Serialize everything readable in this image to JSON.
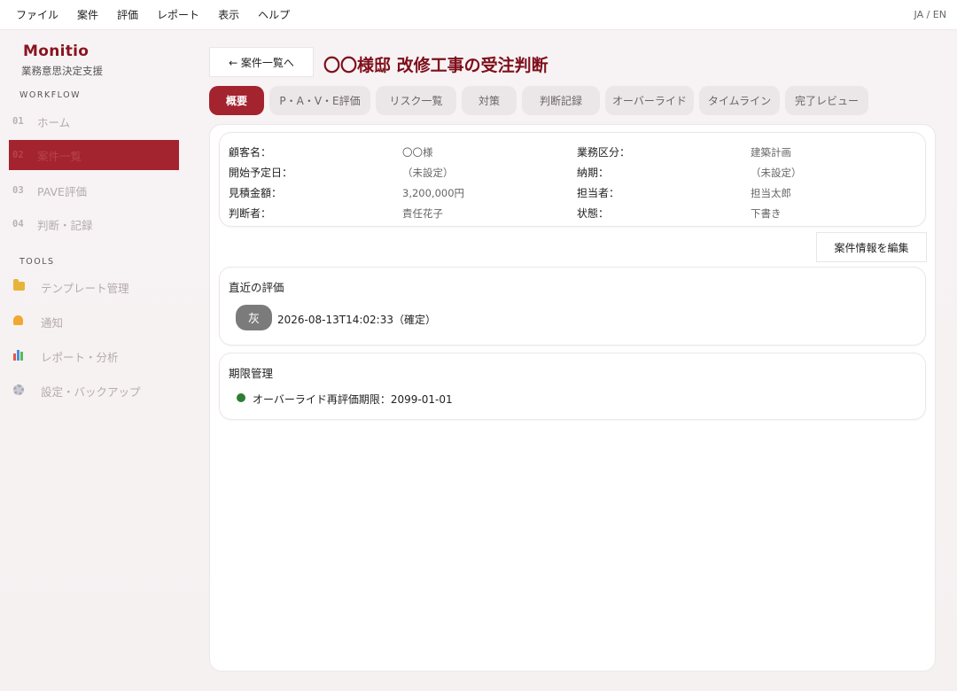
{
  "menubar": {
    "items": [
      "ファイル",
      "案件",
      "評価",
      "レポート",
      "表示",
      "ヘルプ"
    ],
    "lang": "JA / EN"
  },
  "sidebar": {
    "brand": "Monitio",
    "brand_sub": "業務意思決定支援",
    "workflow_title": "WORKFLOW",
    "workflow": [
      {
        "num": "01",
        "label": "ホーム"
      },
      {
        "num": "02",
        "label": "案件一覧"
      },
      {
        "num": "03",
        "label": "PAVE評価"
      },
      {
        "num": "04",
        "label": "判断・記録"
      }
    ],
    "tools_title": "TOOLS",
    "tools": [
      {
        "icon": "folder-icon",
        "label": "テンプレート管理"
      },
      {
        "icon": "bell-icon",
        "label": "通知"
      },
      {
        "icon": "bar-chart-icon",
        "label": "レポート・分析"
      },
      {
        "icon": "gear-icon",
        "label": "設定・バックアップ"
      }
    ]
  },
  "header": {
    "back_label": "← 案件一覧へ",
    "title": "〇〇様邸 改修工事の受注判断"
  },
  "tabs": [
    {
      "label": "概要",
      "active": true
    },
    {
      "label": "P・A・V・E評価"
    },
    {
      "label": "リスク一覧"
    },
    {
      "label": "対策"
    },
    {
      "label": "判断記録"
    },
    {
      "label": "オーバーライド"
    },
    {
      "label": "タイムライン"
    },
    {
      "label": "完了レビュー"
    }
  ],
  "info": {
    "rows": [
      {
        "k1": "顧客名：",
        "v1": "〇〇様",
        "k2": "業務区分：",
        "v2": "建築計画"
      },
      {
        "k1": "開始予定日：",
        "v1": "（未設定）",
        "k2": "納期：",
        "v2": "（未設定）"
      },
      {
        "k1": "見積金額：",
        "v1": "3,200,000円",
        "k2": "担当者：",
        "v2": "担当太郎"
      },
      {
        "k1": "判断者：",
        "v1": "責任花子",
        "k2": "状態：",
        "v2": "下書き"
      }
    ],
    "edit_label": "案件情報を編集"
  },
  "recent_eval": {
    "title": "直近の評価",
    "badge": "灰",
    "text": "2026-08-13T14:02:33（確定）",
    "badge_color": "#7b7b7b"
  },
  "deadline": {
    "title": "期限管理",
    "text": "オーバーライド再評価期限：2099-01-01",
    "dot_color": "#2e7d32"
  },
  "colors": {
    "accent": "#a3232e",
    "title": "#7e0f1a"
  }
}
